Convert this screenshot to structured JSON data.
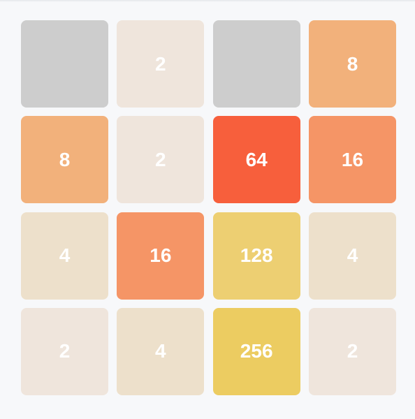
{
  "board": {
    "rows": [
      [
        {
          "value": ""
        },
        {
          "value": "2"
        },
        {
          "value": ""
        },
        {
          "value": "8"
        }
      ],
      [
        {
          "value": "8"
        },
        {
          "value": "2"
        },
        {
          "value": "64"
        },
        {
          "value": "16"
        }
      ],
      [
        {
          "value": "4"
        },
        {
          "value": "16"
        },
        {
          "value": "128"
        },
        {
          "value": "4"
        }
      ],
      [
        {
          "value": "2"
        },
        {
          "value": "4"
        },
        {
          "value": "256"
        },
        {
          "value": "2"
        }
      ]
    ]
  },
  "colors": {
    "empty": "#cdcdcd",
    "2": "#efe5dc",
    "4": "#ede0cb",
    "8": "#f2b17b",
    "16": "#f59566",
    "64": "#f75f3c",
    "128": "#edcf72",
    "256": "#eccc61",
    "text": "#ffffff",
    "background": "#f7f8fa"
  }
}
